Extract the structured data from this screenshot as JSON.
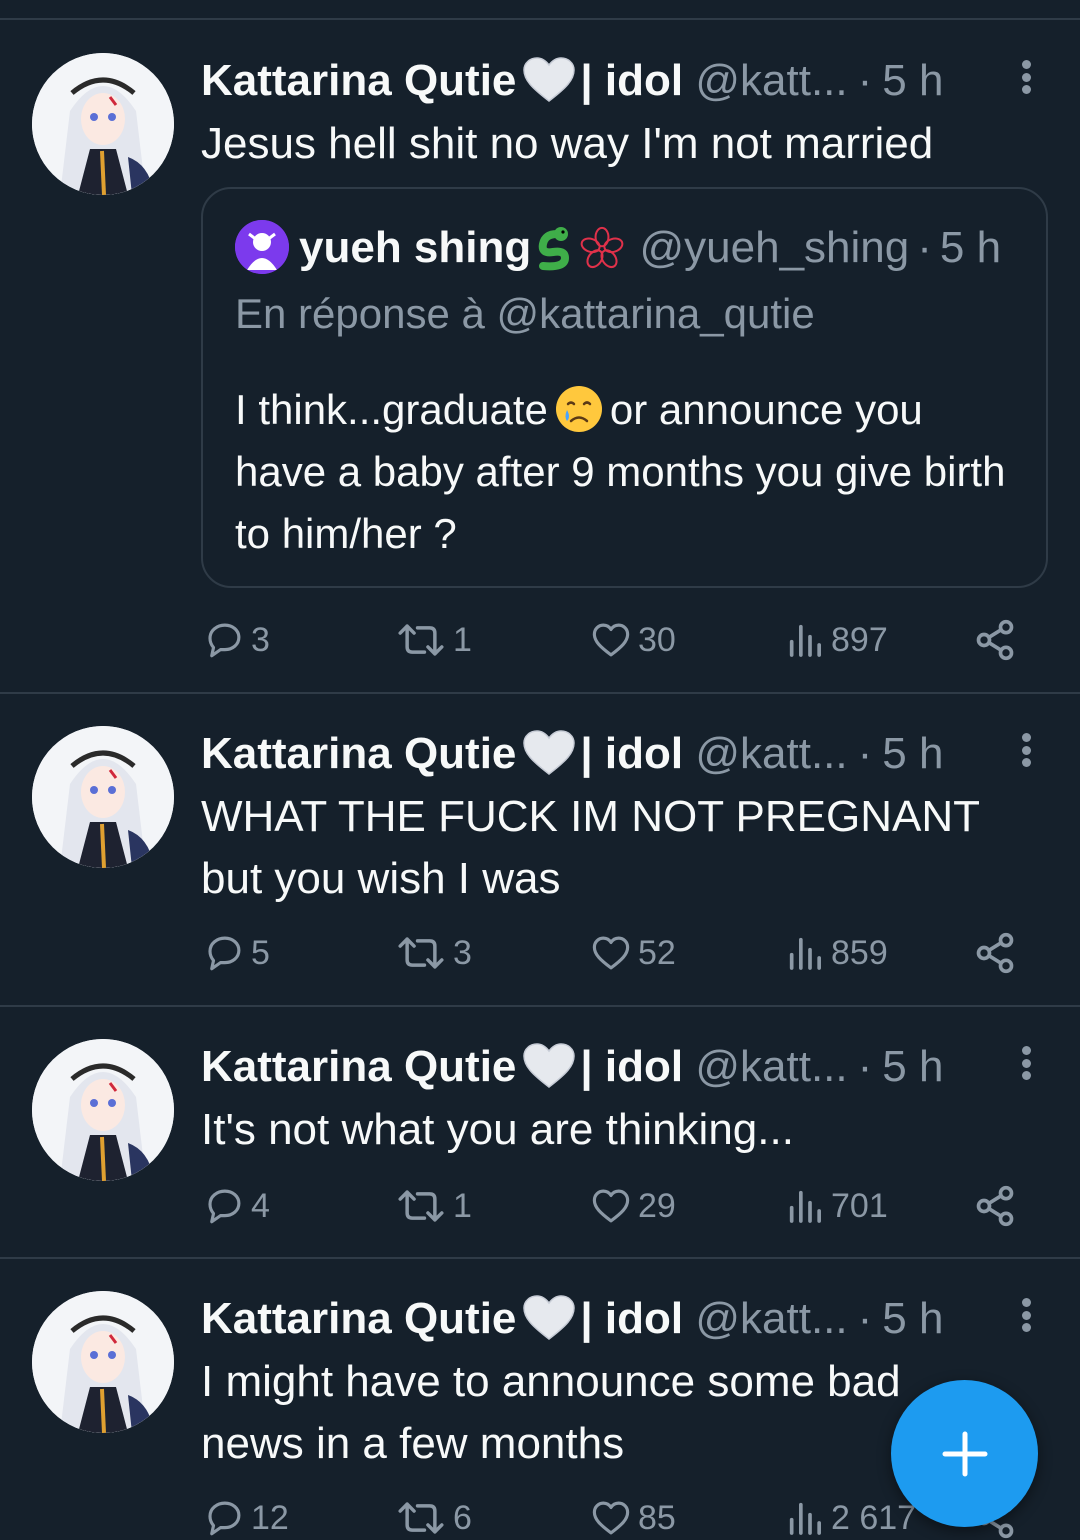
{
  "colors": {
    "background": "#15202b",
    "text": "#f7f9f9",
    "muted": "#8b98a5",
    "divider": "#2f3b47",
    "accent": "#1d9bf0"
  },
  "tweets": [
    {
      "name": "Kattarina Qutie",
      "name_emoji": "white-heart",
      "name_suffix": "| idol",
      "handle": "@katt...",
      "sep": "·",
      "time": "5 h",
      "lines": [
        "Jesus hell shit no way I'm not married"
      ],
      "quote": {
        "name": "yueh shing",
        "emojis": [
          "snake-emoji",
          "sakura-outline-emoji"
        ],
        "handle": "@yueh_shing",
        "sep": "·",
        "time": "5 h",
        "reply_to": "En réponse à @kattarina_qutie",
        "text_before": "I think...graduate",
        "emoji": "crying-face-emoji",
        "text_after": "or announce you have a baby after 9 months you give birth to him/her ?"
      },
      "stats": {
        "replies": "3",
        "retweets": "1",
        "likes": "30",
        "views": "897"
      }
    },
    {
      "name": "Kattarina Qutie",
      "name_emoji": "white-heart",
      "name_suffix": "| idol",
      "handle": "@katt...",
      "sep": "·",
      "time": "5 h",
      "lines": [
        "WHAT THE FUCK IM NOT PREGNANT",
        "but you wish I was"
      ],
      "stats": {
        "replies": "5",
        "retweets": "3",
        "likes": "52",
        "views": "859"
      }
    },
    {
      "name": "Kattarina Qutie",
      "name_emoji": "white-heart",
      "name_suffix": "| idol",
      "handle": "@katt...",
      "sep": "·",
      "time": "5 h",
      "lines": [
        "It's not what you are thinking..."
      ],
      "stats": {
        "replies": "4",
        "retweets": "1",
        "likes": "29",
        "views": "701"
      }
    },
    {
      "name": "Kattarina Qutie",
      "name_emoji": "white-heart",
      "name_suffix": "| idol",
      "handle": "@katt...",
      "sep": "·",
      "time": "5 h",
      "lines": [
        "I might have to announce some bad",
        "news in a few months"
      ],
      "stats": {
        "replies": "12",
        "retweets": "6",
        "likes": "85",
        "views": "2 617"
      }
    }
  ],
  "fab": {
    "icon": "plus-icon"
  }
}
